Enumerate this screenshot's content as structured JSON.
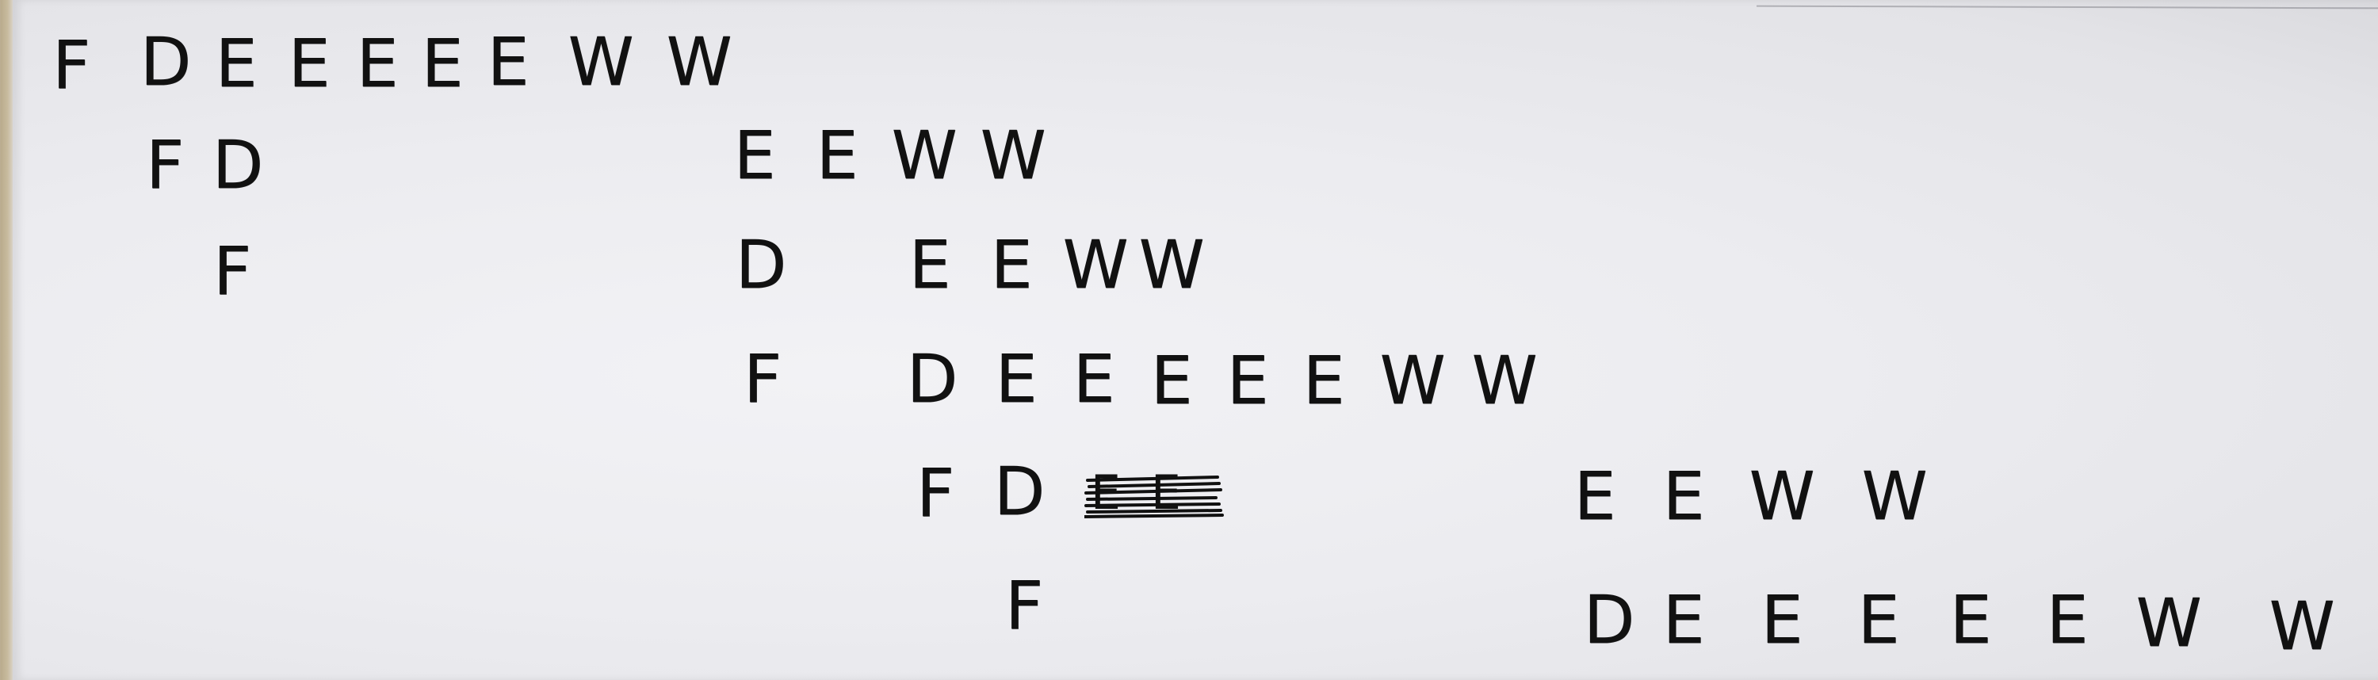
{
  "rows": [
    [
      "F",
      "D",
      "E",
      "E",
      "E",
      "E",
      "E",
      "W",
      "W"
    ],
    [
      "F",
      "D",
      "E",
      "E",
      "W",
      "W"
    ],
    [
      "F",
      "D",
      "E",
      "E",
      "W",
      "W"
    ],
    [
      "F",
      "D",
      "E",
      "E",
      "E",
      "E",
      "E",
      "W",
      "W"
    ],
    [
      "F",
      "D",
      "E",
      "E",
      "W",
      "W"
    ],
    [
      "F",
      "D",
      "E",
      "E",
      "E",
      "E",
      "E",
      "W",
      "W"
    ]
  ],
  "crossed_out": [
    "E",
    "E"
  ],
  "colors": {
    "ink": "#111111",
    "paper": "#ededf1"
  }
}
